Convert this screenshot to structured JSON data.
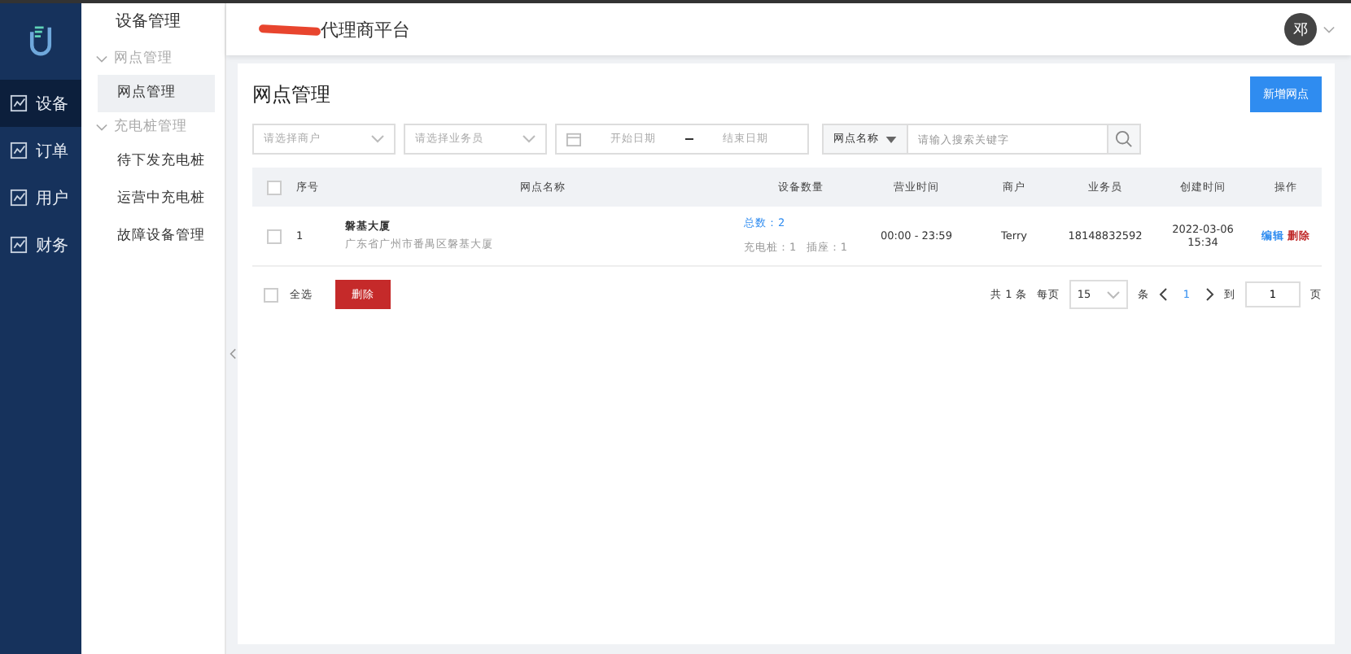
{
  "nav": {
    "items": [
      {
        "label": "设备",
        "selected": true
      },
      {
        "label": "订单",
        "selected": false
      },
      {
        "label": "用户",
        "selected": false
      },
      {
        "label": "财务",
        "selected": false
      }
    ]
  },
  "submenu": {
    "title": "设备管理",
    "groups": [
      {
        "label": "网点管理",
        "expanded": true,
        "items": [
          {
            "label": "网点管理",
            "selected": true
          }
        ]
      },
      {
        "label": "充电桩管理",
        "expanded": true,
        "items": [
          {
            "label": "待下发充电桩",
            "selected": false
          },
          {
            "label": "运营中充电桩",
            "selected": false
          },
          {
            "label": "故障设备管理",
            "selected": false
          }
        ]
      }
    ]
  },
  "header": {
    "title": "代理商平台",
    "avatar": "邓"
  },
  "page": {
    "title": "网点管理",
    "add_button": "新增网点"
  },
  "filters": {
    "merchant_placeholder": "请选择商户",
    "salesman_placeholder": "请选择业务员",
    "start_placeholder": "开始日期",
    "end_placeholder": "结束日期",
    "search_type": "网点名称",
    "search_placeholder": "请输入搜索关键字"
  },
  "table": {
    "header_checked": false,
    "columns": [
      "序号",
      "网点名称",
      "设备数量",
      "营业时间",
      "商户",
      "业务员",
      "创建时间",
      "操作"
    ],
    "rows": [
      {
        "checked": false,
        "index": "1",
        "name": "磐基大厦",
        "address": "广东省广州市番禺区磐基大厦",
        "total": "总数：2",
        "detail": "充电桩：1   插座：1",
        "hours": "00:00 - 23:59",
        "merchant": "Terry",
        "salesman": "18148832592",
        "created": "2022-03-06 15:34",
        "edit": "编辑",
        "delete": "删除"
      }
    ]
  },
  "footer": {
    "select_all": "全选",
    "select_all_checked": false,
    "delete_button": "删除",
    "total": "共 1 条",
    "per_page_label": "每页",
    "per_page": "15",
    "per_page_unit": "条",
    "current_page": "1",
    "goto_label": "到",
    "goto_value": "1",
    "page_unit": "页"
  }
}
